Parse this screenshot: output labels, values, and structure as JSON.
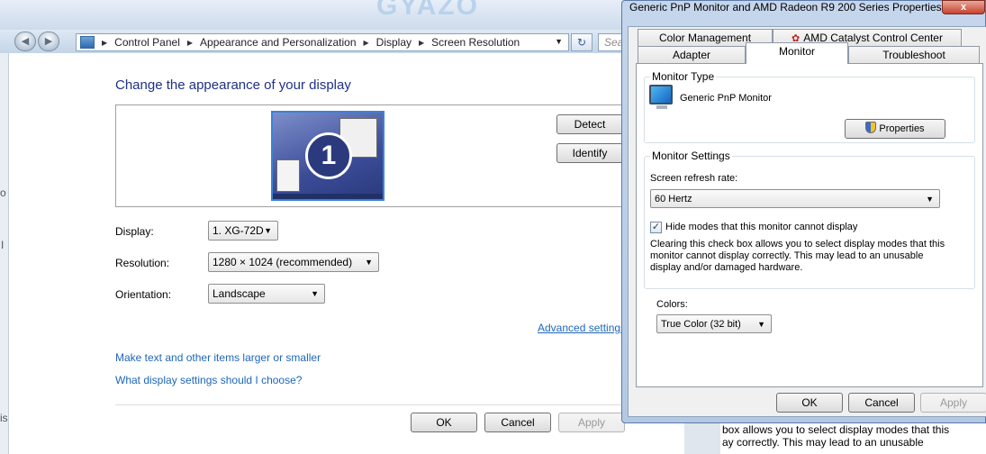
{
  "control_panel": {
    "watermark": "GYAZO",
    "breadcrumbs": [
      "Control Panel",
      "Appearance and Personalization",
      "Display",
      "Screen Resolution"
    ],
    "search_placeholder": "Sea",
    "title": "Change the appearance of your display",
    "monitor_number": "1",
    "detect_label": "Detect",
    "identify_label": "Identify",
    "display_label": "Display:",
    "display_value": "1. XG-72D",
    "resolution_label": "Resolution:",
    "resolution_value": "1280 × 1024 (recommended)",
    "orientation_label": "Orientation:",
    "orientation_value": "Landscape",
    "advanced_settings": "Advanced settings",
    "link_text_size": "Make text and other items larger or smaller",
    "link_display_settings": "What display settings should I choose?",
    "ok_label": "OK",
    "cancel_label": "Cancel",
    "apply_label": "Apply",
    "left_edge_chars": [
      "o",
      "I",
      "is"
    ]
  },
  "dialog": {
    "title": "Generic PnP Monitor and AMD Radeon R9 200 Series Properties",
    "close_label": "x",
    "tabs_row1": [
      "Color Management",
      "AMD Catalyst Control Center"
    ],
    "tabs_row2": [
      "Adapter",
      "Monitor",
      "Troubleshoot"
    ],
    "active_tab": "Monitor",
    "monitor_type_group": "Monitor Type",
    "monitor_name": "Generic PnP Monitor",
    "properties_label": "Properties",
    "monitor_settings_group": "Monitor Settings",
    "refresh_rate_label": "Screen refresh rate:",
    "refresh_rate_value": "60 Hertz",
    "hide_modes_label": "Hide modes that this monitor cannot display",
    "hide_modes_checked": true,
    "hide_modes_note": "Clearing this check box allows you to select display modes that this monitor cannot display correctly. This may lead to an unusable display and/or damaged hardware.",
    "colors_label": "Colors:",
    "colors_value": "True Color (32 bit)",
    "ok_label": "OK",
    "cancel_label": "Cancel",
    "apply_label": "Apply"
  },
  "background_text": {
    "line1": "box allows you to select display modes that this",
    "line2": "ay correctly. This may lead to an unusable"
  },
  "colors": {
    "title_blue": "#1e3287",
    "link_blue": "#1e66b9",
    "monitor_accent": "#3b82d6"
  }
}
